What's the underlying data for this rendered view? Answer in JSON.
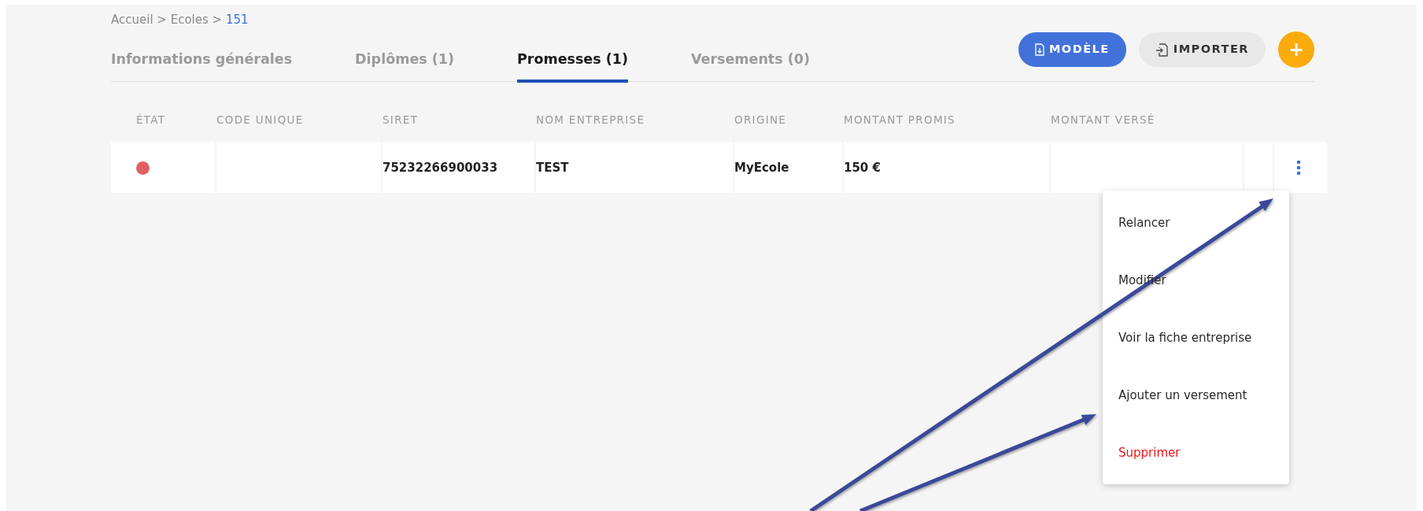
{
  "breadcrumb": [
    {
      "label": "Accueil",
      "current": false
    },
    {
      "label": "Ecoles",
      "current": false
    },
    {
      "label": "151",
      "current": true
    }
  ],
  "breadcrumb_separator": ">",
  "tabs": [
    {
      "label": "Informations générales",
      "selected": false
    },
    {
      "label": "Diplômes (1)",
      "selected": false
    },
    {
      "label": "Promesses (1)",
      "selected": true
    },
    {
      "label": "Versements (0)",
      "selected": false
    }
  ],
  "actions": [
    {
      "kind": "primary",
      "label": "MODÈLE"
    },
    {
      "kind": "secondary",
      "label": "IMPORTER"
    },
    {
      "kind": "add",
      "label": "+"
    }
  ],
  "table": {
    "columns": [
      "ÉTAT",
      "CODE UNIQUE",
      "SIRET",
      "NOM ENTREPRISE",
      "ORIGINE",
      "MONTANT PROMIS",
      "MONTANT VERSÉ"
    ],
    "rows": [
      {
        "color": "#e06060",
        "siret": "75232266900033",
        "company": "TEST",
        "origin": "MyEcole",
        "promised": "150 €"
      }
    ]
  },
  "row_menu": [
    {
      "label": "Relancer",
      "kind": "normal"
    },
    {
      "label": "Modifier",
      "kind": "normal"
    },
    {
      "label": "Voir la fiche entreprise",
      "kind": "normal"
    },
    {
      "label": "Ajouter un versement",
      "kind": "normal"
    },
    {
      "label": "Supprimer",
      "kind": "danger"
    }
  ]
}
